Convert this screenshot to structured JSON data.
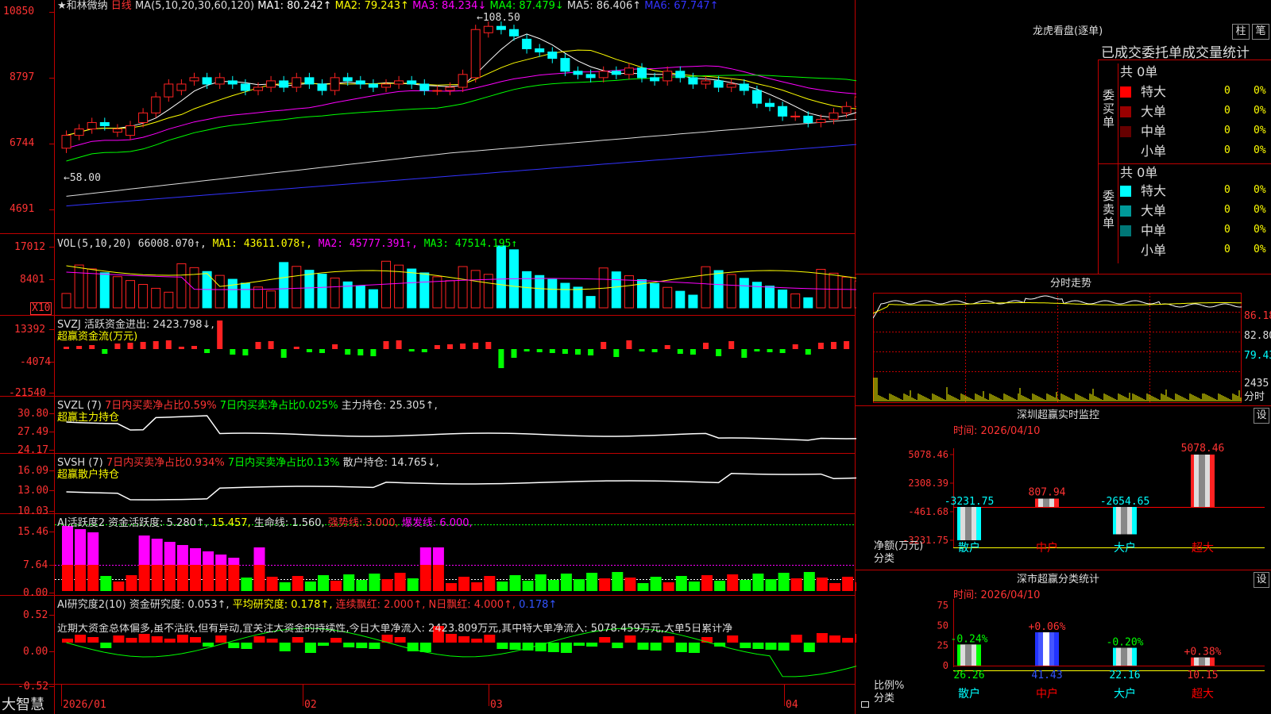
{
  "header": {
    "stock_name": "★和林微纳",
    "period": "日线",
    "ma_prefix": "MA(5,10,20,30,60,120)",
    "ma_values": [
      {
        "label": "MA1: 80.242↑",
        "color": "#ffffff"
      },
      {
        "label": "MA2: 79.243↑",
        "color": "#ffff00"
      },
      {
        "label": "MA3: 84.234↓",
        "color": "#ff00ff"
      },
      {
        "label": "MA4: 87.479↓",
        "color": "#00ff00"
      },
      {
        "label": "MA5: 86.406↑",
        "color": "#dddddd"
      },
      {
        "label": "MA6: 67.747↑",
        "color": "#3333ff"
      }
    ]
  },
  "price_panel": {
    "y_ticks": [
      "10850",
      "8797",
      "6744",
      "4691"
    ],
    "high_label": "108.50",
    "low_label": "58.00"
  },
  "vol_panel": {
    "title": "VOL(5,10,20)",
    "value": "66008.070↑,",
    "ma1": "MA1: 43611.078↑,",
    "ma2": "MA2: 45777.391↑,",
    "ma3": "MA3: 47514.195↑",
    "y_ticks": [
      "17012",
      "8401"
    ],
    "unit": "X10"
  },
  "svzj_panel": {
    "title": "SVZJ  活跃资金进出: 2423.798↓,",
    "subtitle": "超赢资金流(万元)",
    "y_ticks": [
      "13392",
      "-4074",
      "-21540"
    ]
  },
  "svzl_panel": {
    "title": "SVZL (7)",
    "part1": "7日内买卖净占比0.59%",
    "part2": "7日内买卖净占比0.025%",
    "part3": "主力持仓: 25.305↑,",
    "subtitle": "超赢主力持仓",
    "y_ticks": [
      "30.80",
      "27.49",
      "24.17"
    ]
  },
  "svsh_panel": {
    "title": "SVSH (7)",
    "part1": "7日内买卖净占比0.934%",
    "part2": "7日内买卖净占比0.13%",
    "part3": "散户持仓: 14.765↓,",
    "subtitle": "超赢散户持仓",
    "y_ticks": [
      "16.09",
      "13.00",
      "10.03"
    ]
  },
  "ai_active_panel": {
    "title": "AI活跃度2 资金活跃度: 5.280↑,",
    "v2": "15.457,",
    "v3": "生命线: 1.560,",
    "v4": "强势线: 3.000,",
    "v5": "爆发线: 6.000,",
    "y_ticks": [
      "15.46",
      "7.64",
      "0.00"
    ]
  },
  "ai_research_panel": {
    "title": "AI研究度2(10) 资金研究度: 0.053↑,",
    "v2": "平均研究度: 0.178↑,",
    "v3": "连续飘红: 2.000↑,",
    "v4": "N日飘红: 4.000↑,",
    "v5": "0.178↑",
    "note": "近期大资金总体偏多,虽不活跃,但有异动,宜关注大资金的持续性,今日大单净流入: 2423.809万元,其中特大单净流入: 5078.459万元,大单5日累计净",
    "y_ticks": [
      "0.52",
      "0.00",
      "-0.52"
    ]
  },
  "bottom_axis": {
    "brand": "大智慧",
    "dates": [
      "2026/01",
      "02",
      "03",
      "04"
    ]
  },
  "dragon_tiger": {
    "title": "龙虎看盘(逐单)",
    "btn_bars": "柱",
    "btn_pen": "笔",
    "tabs_text": "已成交委托单成交量统计",
    "buy_label": "委买单",
    "sell_label": "委卖单",
    "buy_total": "共 0单",
    "sell_total": "共 0单",
    "rows_buy": [
      {
        "name": "特大",
        "qty": "0",
        "pct": "0%",
        "color": "#ff0000"
      },
      {
        "name": "大单",
        "qty": "0",
        "pct": "0%",
        "color": "#990000"
      },
      {
        "name": "中单",
        "qty": "0",
        "pct": "0%",
        "color": "#660000"
      },
      {
        "name": "小单",
        "qty": "0",
        "pct": "0%",
        "color": "#000000"
      }
    ],
    "rows_sell": [
      {
        "name": "特大",
        "qty": "0",
        "pct": "0%",
        "color": "#00ffff"
      },
      {
        "name": "大单",
        "qty": "0",
        "pct": "0%",
        "color": "#009999"
      },
      {
        "name": "中单",
        "qty": "0",
        "pct": "0%",
        "color": "#007777"
      },
      {
        "name": "小单",
        "qty": "0",
        "pct": "0%",
        "color": "#000000"
      }
    ]
  },
  "intraday": {
    "title": "分时走势",
    "y_ticks": [
      "86.18",
      "82.80",
      "79.43"
    ],
    "vol_tick": "2435",
    "vol_label": "分时"
  },
  "sz_monitor": {
    "title": "深圳超赢实时监控",
    "btn": "设",
    "time": "时间: 2026/04/10",
    "y_ticks": [
      "5078.46",
      "2308.39",
      "-461.68",
      "-3231.75"
    ],
    "ylabel": "净额(万元)",
    "xlabel": "分类",
    "cats": [
      "散户",
      "中户",
      "大户",
      "超大"
    ],
    "cat_colors": [
      "#00ffff",
      "#ff0000",
      "#00ffff",
      "#ff0000"
    ],
    "value_labels": [
      "-3231.75",
      "807.94",
      "-2654.65",
      "5078.46"
    ],
    "value_colors": [
      "#00ffff",
      "#ff3333",
      "#00ffff",
      "#ff3333"
    ]
  },
  "sz_class": {
    "title": "深市超赢分类统计",
    "btn": "设",
    "time": "时间: 2026/04/10",
    "y_ticks": [
      "75",
      "50",
      "25",
      "0"
    ],
    "ylabel": "比例%",
    "xlabel": "分类",
    "cats": [
      "散户",
      "中户",
      "大户",
      "超大"
    ],
    "cat_colors": [
      "#00ffff",
      "#ff0000",
      "#00ffff",
      "#ff0000"
    ],
    "value_labels": [
      "26.26",
      "41.43",
      "22.16",
      "10.15"
    ],
    "value_colors": [
      "#00ff00",
      "#3355ff",
      "#00ffff",
      "#ff3333"
    ],
    "change_labels": [
      "-0.24%",
      "+0.06%",
      "-0.20%",
      "+0.38%"
    ],
    "change_colors": [
      "#00ff00",
      "#ff3333",
      "#00ff00",
      "#ff3333"
    ]
  },
  "chart_data": [
    {
      "type": "bar",
      "title": "深圳超赢实时监控",
      "ylabel": "净额(万元)",
      "xlabel": "分类",
      "categories": [
        "散户",
        "中户",
        "大户",
        "超大"
      ],
      "values": [
        -3231.75,
        807.94,
        -2654.65,
        5078.46
      ],
      "ylim": [
        -3231.75,
        5078.46
      ]
    },
    {
      "type": "bar",
      "title": "深市超赢分类统计",
      "ylabel": "比例%",
      "xlabel": "分类",
      "categories": [
        "散户",
        "中户",
        "大户",
        "超大"
      ],
      "values": [
        26.26,
        41.43,
        22.16,
        10.15
      ],
      "ylim": [
        0,
        75
      ]
    },
    {
      "type": "bar",
      "title": "candlestick",
      "series": [
        {
          "name": "open",
          "values": [
            66,
            70,
            72,
            74,
            71,
            70,
            74,
            77,
            82,
            84,
            87,
            88,
            86,
            87,
            86,
            84,
            85,
            87,
            85,
            88,
            86,
            84,
            88,
            87,
            86,
            85,
            86,
            87,
            86,
            84,
            84,
            85,
            88,
            102,
            104,
            103,
            100,
            97,
            96,
            94,
            90,
            89,
            88,
            90,
            89,
            91,
            88,
            87,
            90,
            88,
            86,
            87,
            85,
            86,
            84,
            80,
            79,
            76,
            76,
            74,
            75,
            77,
            79
          ]
        },
        {
          "name": "close",
          "values": [
            70,
            72,
            74,
            73,
            72,
            73,
            77,
            82,
            86,
            86,
            88,
            86,
            88,
            86,
            84,
            85,
            87,
            85,
            88,
            86,
            84,
            88,
            87,
            86,
            85,
            86,
            87,
            86,
            84,
            84,
            85,
            89,
            103,
            104,
            103,
            101,
            97,
            96,
            94,
            90,
            89,
            88,
            90,
            89,
            91,
            88,
            87,
            90,
            88,
            86,
            87,
            85,
            86,
            84,
            80,
            79,
            76,
            76,
            74,
            75,
            77,
            79,
            82
          ]
        }
      ]
    }
  ]
}
